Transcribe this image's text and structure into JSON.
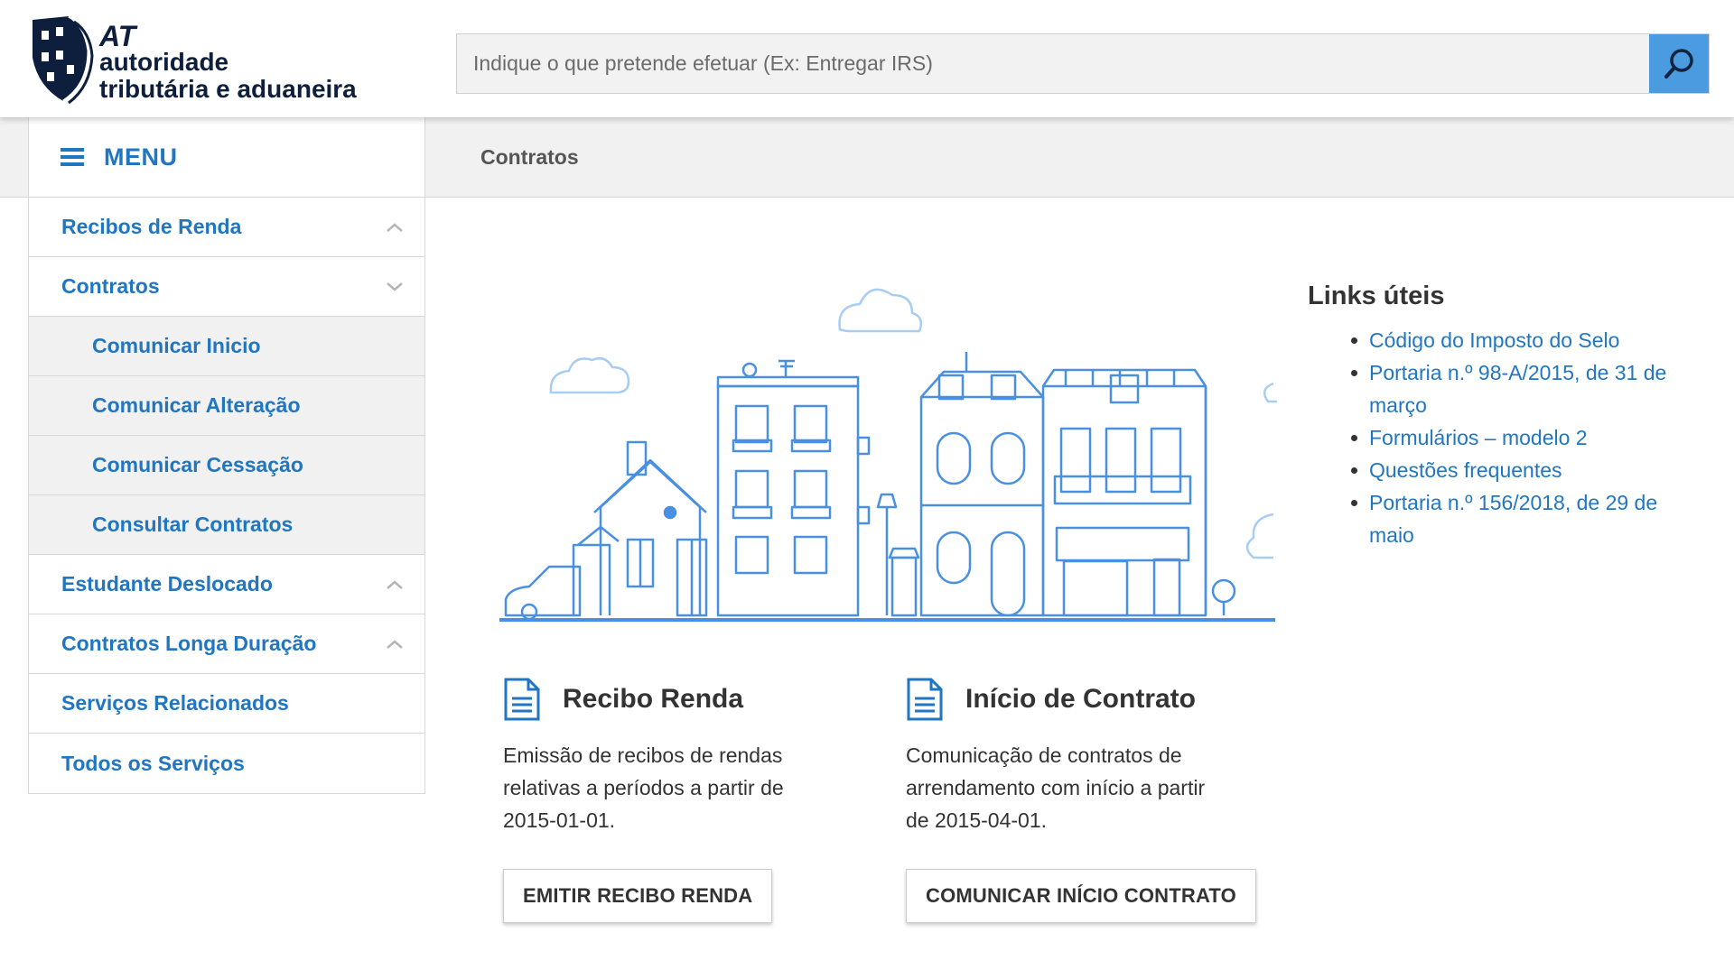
{
  "header": {
    "logo": {
      "line1": "AT",
      "line2": "autoridade",
      "line3": "tributária e aduaneira"
    },
    "search": {
      "placeholder": "Indique o que pretende efetuar (Ex: Entregar IRS)",
      "icon": "search-icon"
    }
  },
  "menu": {
    "label": "MENU",
    "icon": "hamburger-icon"
  },
  "breadcrumb": "Contratos",
  "sidebar": {
    "items": [
      {
        "label": "Recibos de Renda",
        "chevron": "up"
      },
      {
        "label": "Contratos",
        "chevron": "down"
      },
      {
        "label": "Comunicar Inicio",
        "sub": true
      },
      {
        "label": "Comunicar Alteração",
        "sub": true
      },
      {
        "label": "Comunicar Cessação",
        "sub": true
      },
      {
        "label": "Consultar Contratos",
        "sub": true
      },
      {
        "label": "Estudante Deslocado",
        "chevron": "up"
      },
      {
        "label": "Contratos Longa Duração",
        "chevron": "up"
      },
      {
        "label": "Serviços Relacionados"
      },
      {
        "label": "Todos os Serviços"
      }
    ]
  },
  "cards": [
    {
      "title": "Recibo Renda",
      "description": "Emissão de recibos de rendas relativas a períodos a partir de 2015-01-01.",
      "button": "EMITIR RECIBO RENDA",
      "icon": "document-icon"
    },
    {
      "title": "Início de Contrato",
      "description": "Comunicação de contratos de arrendamento com início a partir de 2015-04-01.",
      "button": "COMUNICAR INÍCIO CONTRATO",
      "icon": "document-icon"
    }
  ],
  "links": {
    "title": "Links úteis",
    "items": [
      "Código do Imposto do Selo",
      "Portaria n.º 98-A/2015, de 31 de março",
      "Formulários – modelo 2",
      "Questões frequentes",
      "Portaria n.º 156/2018, de 29 de maio"
    ]
  },
  "colors": {
    "accent": "#2176c2",
    "search_button": "#4a9bdf",
    "logo_navy": "#0e1f3d",
    "illustration": "#4a90e2"
  }
}
